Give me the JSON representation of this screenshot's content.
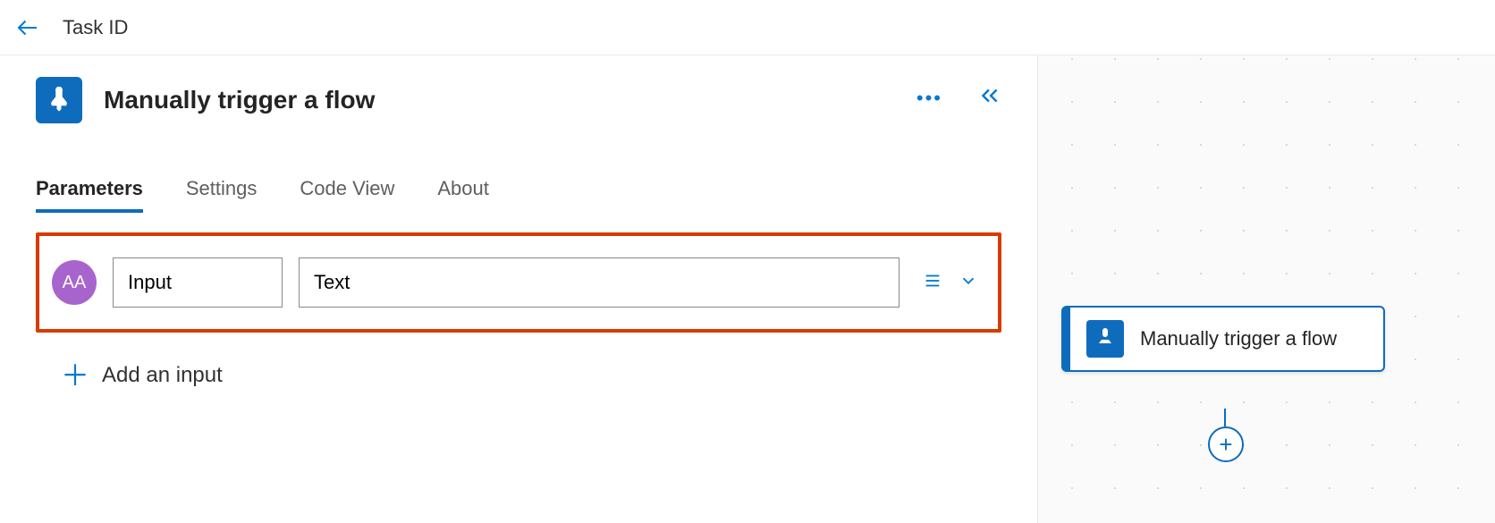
{
  "header": {
    "title": "Task ID"
  },
  "trigger": {
    "title": "Manually trigger a flow"
  },
  "tabs": {
    "items": [
      {
        "label": "Parameters",
        "active": true
      },
      {
        "label": "Settings",
        "active": false
      },
      {
        "label": "Code View",
        "active": false
      },
      {
        "label": "About",
        "active": false
      }
    ]
  },
  "parameters": {
    "inputs": [
      {
        "type_badge": "AA",
        "name": "Input",
        "value": "Text"
      }
    ],
    "add_label": "Add an input"
  },
  "canvas": {
    "node_label": "Manually trigger a flow"
  }
}
